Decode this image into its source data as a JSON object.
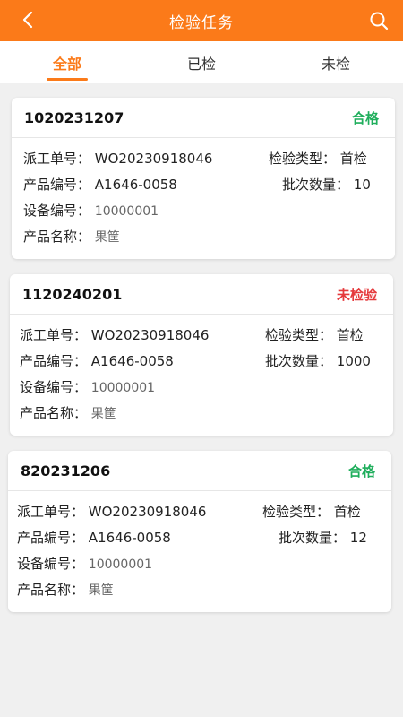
{
  "header": {
    "title": "检验任务",
    "back_icon": "chevron-left-icon",
    "search_icon": "search-icon",
    "color": "#fb7a19"
  },
  "tabs": [
    {
      "label": "全部",
      "active": true
    },
    {
      "label": "已检",
      "active": false
    },
    {
      "label": "未检",
      "active": false
    }
  ],
  "labels": {
    "dispatch_no": "派工单号：",
    "product_no": "产品编号：",
    "device_no": "设备编号：",
    "product_name": "产品名称：",
    "inspect_type": "检验类型：",
    "batch_qty": "批次数量："
  },
  "cards": [
    {
      "id": "1020231207",
      "status": "合格",
      "dispatch_no": "WO20230918046",
      "product_no": "A1646-0058",
      "device_no": "10000001",
      "product_name": "果筐",
      "inspect_type": "首检",
      "batch_qty": "10"
    },
    {
      "id": "1120240201",
      "status": "未检验",
      "dispatch_no": "WO20230918046",
      "product_no": "A1646-0058",
      "device_no": "10000001",
      "product_name": "果筐",
      "inspect_type": "首检",
      "batch_qty": "1000"
    },
    {
      "id": "820231206",
      "status": "合格",
      "dispatch_no": "WO20230918046",
      "product_no": "A1646-0058",
      "device_no": "10000001",
      "product_name": "果筐",
      "inspect_type": "首检",
      "batch_qty": "12"
    }
  ]
}
